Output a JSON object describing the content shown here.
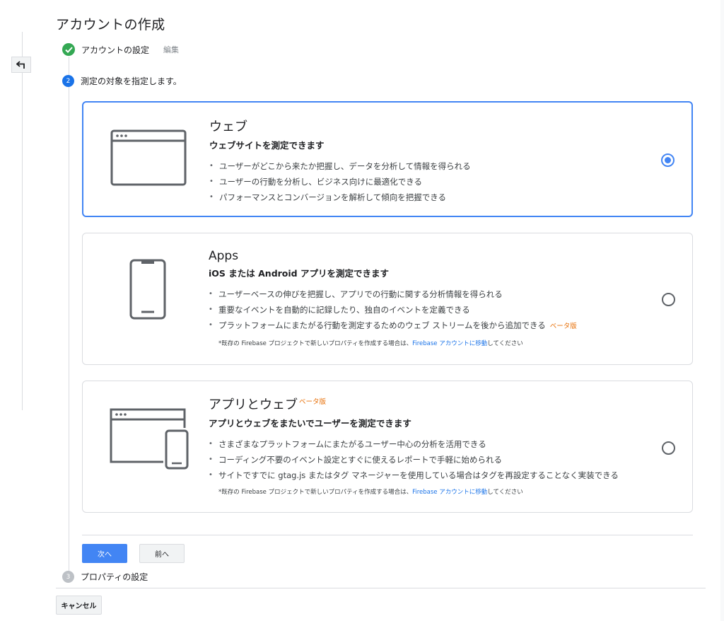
{
  "page_title": "アカウントの作成",
  "steps": {
    "step1": {
      "label": "アカウントの設定",
      "edit": "編集"
    },
    "step2": {
      "number": "2",
      "label": "測定の対象を指定します。"
    },
    "step3": {
      "number": "3",
      "label": "プロパティの設定"
    }
  },
  "cards": {
    "web": {
      "title": "ウェブ",
      "subtitle": "ウェブサイトを測定できます",
      "bullets": [
        "ユーザーがどこから来たか把握し、データを分析して情報を得られる",
        "ユーザーの行動を分析し、ビジネス向けに最適化できる",
        "パフォーマンスとコンバージョンを解析して傾向を把握できる"
      ],
      "selected": true,
      "icon": "browser-window-icon"
    },
    "apps": {
      "title": "Apps",
      "subtitle": "iOS または Android アプリを測定できます",
      "bullets": [
        "ユーザーベースの伸びを把握し、アプリでの行動に関する分析情報を得られる",
        "重要なイベントを自動的に記録したり、独自のイベントを定義できる",
        "プラットフォームにまたがる行動を測定するためのウェブ ストリームを後から追加できる"
      ],
      "beta": "ベータ版",
      "note_prefix": "*既存の Firebase プロジェクトで新しいプロパティを作成する場合は、",
      "note_link": "Firebase アカウントに移動",
      "note_suffix": "してください",
      "selected": false,
      "icon": "smartphone-icon"
    },
    "both": {
      "title": "アプリとウェブ",
      "beta": "ベータ版",
      "subtitle": "アプリとウェブをまたいでユーザーを測定できます",
      "bullets": [
        "さまざまなプラットフォームにまたがるユーザー中心の分析を活用できる",
        "コーディング不要のイベント設定とすぐに使えるレポートで手軽に始められる",
        "サイトですでに gtag.js またはタグ マネージャーを使用している場合はタグを再設定することなく実装できる"
      ],
      "note_prefix": "*既存の Firebase プロジェクトで新しいプロパティを作成する場合は、",
      "note_link": "Firebase アカウントに移動",
      "note_suffix": "してください",
      "selected": false,
      "icon": "browser-and-phone-icon"
    }
  },
  "buttons": {
    "next": "次へ",
    "prev": "前へ",
    "cancel": "キャンセル"
  },
  "colors": {
    "accent": "#4285f4",
    "success": "#34a853",
    "beta": "#e8710a",
    "link": "#1a73e8"
  }
}
